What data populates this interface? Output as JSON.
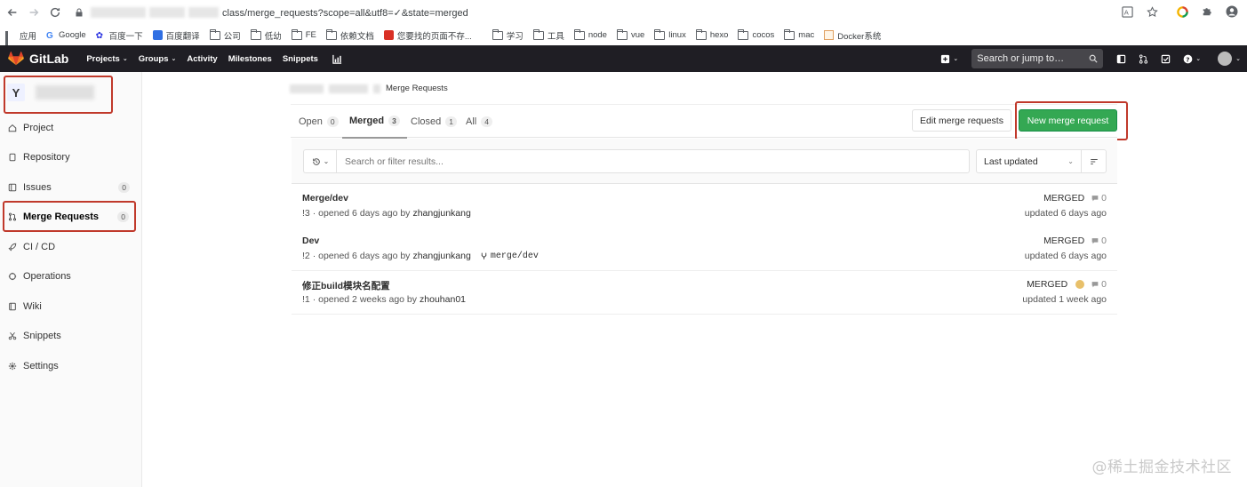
{
  "browser": {
    "url_visible": "class/merge_requests?scope=all&utf8=✓&state=merged",
    "bookmarks": [
      "应用",
      "Google",
      "百度一下",
      "百度翻译",
      "公司",
      "低幼",
      "FE",
      "依赖文档",
      "您要找的页面不存...",
      "学习",
      "工具",
      "node",
      "vue",
      "linux",
      "hexo",
      "cocos",
      "mac",
      "Docker系统"
    ]
  },
  "topnav": {
    "brand": "GitLab",
    "items": [
      {
        "label": "Projects",
        "dropdown": true
      },
      {
        "label": "Groups",
        "dropdown": true
      },
      {
        "label": "Activity",
        "dropdown": false
      },
      {
        "label": "Milestones",
        "dropdown": false
      },
      {
        "label": "Snippets",
        "dropdown": false
      }
    ],
    "search_placeholder": "Search or jump to…"
  },
  "sidebar": {
    "project_initial": "Y",
    "items": [
      {
        "label": "Project",
        "icon": "home-icon",
        "count": ""
      },
      {
        "label": "Repository",
        "icon": "doc-icon",
        "count": ""
      },
      {
        "label": "Issues",
        "icon": "issues-icon",
        "count": "0"
      },
      {
        "label": "Merge Requests",
        "icon": "merge-request-icon",
        "count": "0",
        "active": true
      },
      {
        "label": "CI / CD",
        "icon": "rocket-icon",
        "count": ""
      },
      {
        "label": "Operations",
        "icon": "operations-icon",
        "count": ""
      },
      {
        "label": "Wiki",
        "icon": "book-icon",
        "count": ""
      },
      {
        "label": "Snippets",
        "icon": "scissors-icon",
        "count": ""
      },
      {
        "label": "Settings",
        "icon": "gear-icon",
        "count": ""
      }
    ]
  },
  "breadcrumb": {
    "current": "Merge Requests"
  },
  "tabs": [
    {
      "label": "Open",
      "count": "0"
    },
    {
      "label": "Merged",
      "count": "3",
      "active": true
    },
    {
      "label": "Closed",
      "count": "1"
    },
    {
      "label": "All",
      "count": "4"
    }
  ],
  "actions": {
    "edit_label": "Edit merge requests",
    "new_label": "New merge request",
    "new_color": "#34a853"
  },
  "filter": {
    "search_placeholder": "Search or filter results...",
    "sort_label": "Last updated"
  },
  "merge_requests": [
    {
      "title": "Merge/dev",
      "ref": "!3",
      "opened": "· opened 6 days ago by",
      "author": "zhangjunkang",
      "branch": "",
      "status": "MERGED",
      "comments": "0",
      "updated": "updated 6 days ago"
    },
    {
      "title": "Dev",
      "ref": "!2",
      "opened": "· opened 6 days ago by",
      "author": "zhangjunkang",
      "branch": "merge/dev",
      "status": "MERGED",
      "comments": "0",
      "updated": "updated 6 days ago"
    },
    {
      "title": "修正build模块名配置",
      "ref": "!1",
      "opened": "· opened 2 weeks ago by",
      "author": "zhouhan01",
      "branch": "",
      "status": "MERGED",
      "comments": "0",
      "updated": "updated 1 week ago",
      "assignee": true
    }
  ],
  "watermark": "@稀土掘金技术社区"
}
